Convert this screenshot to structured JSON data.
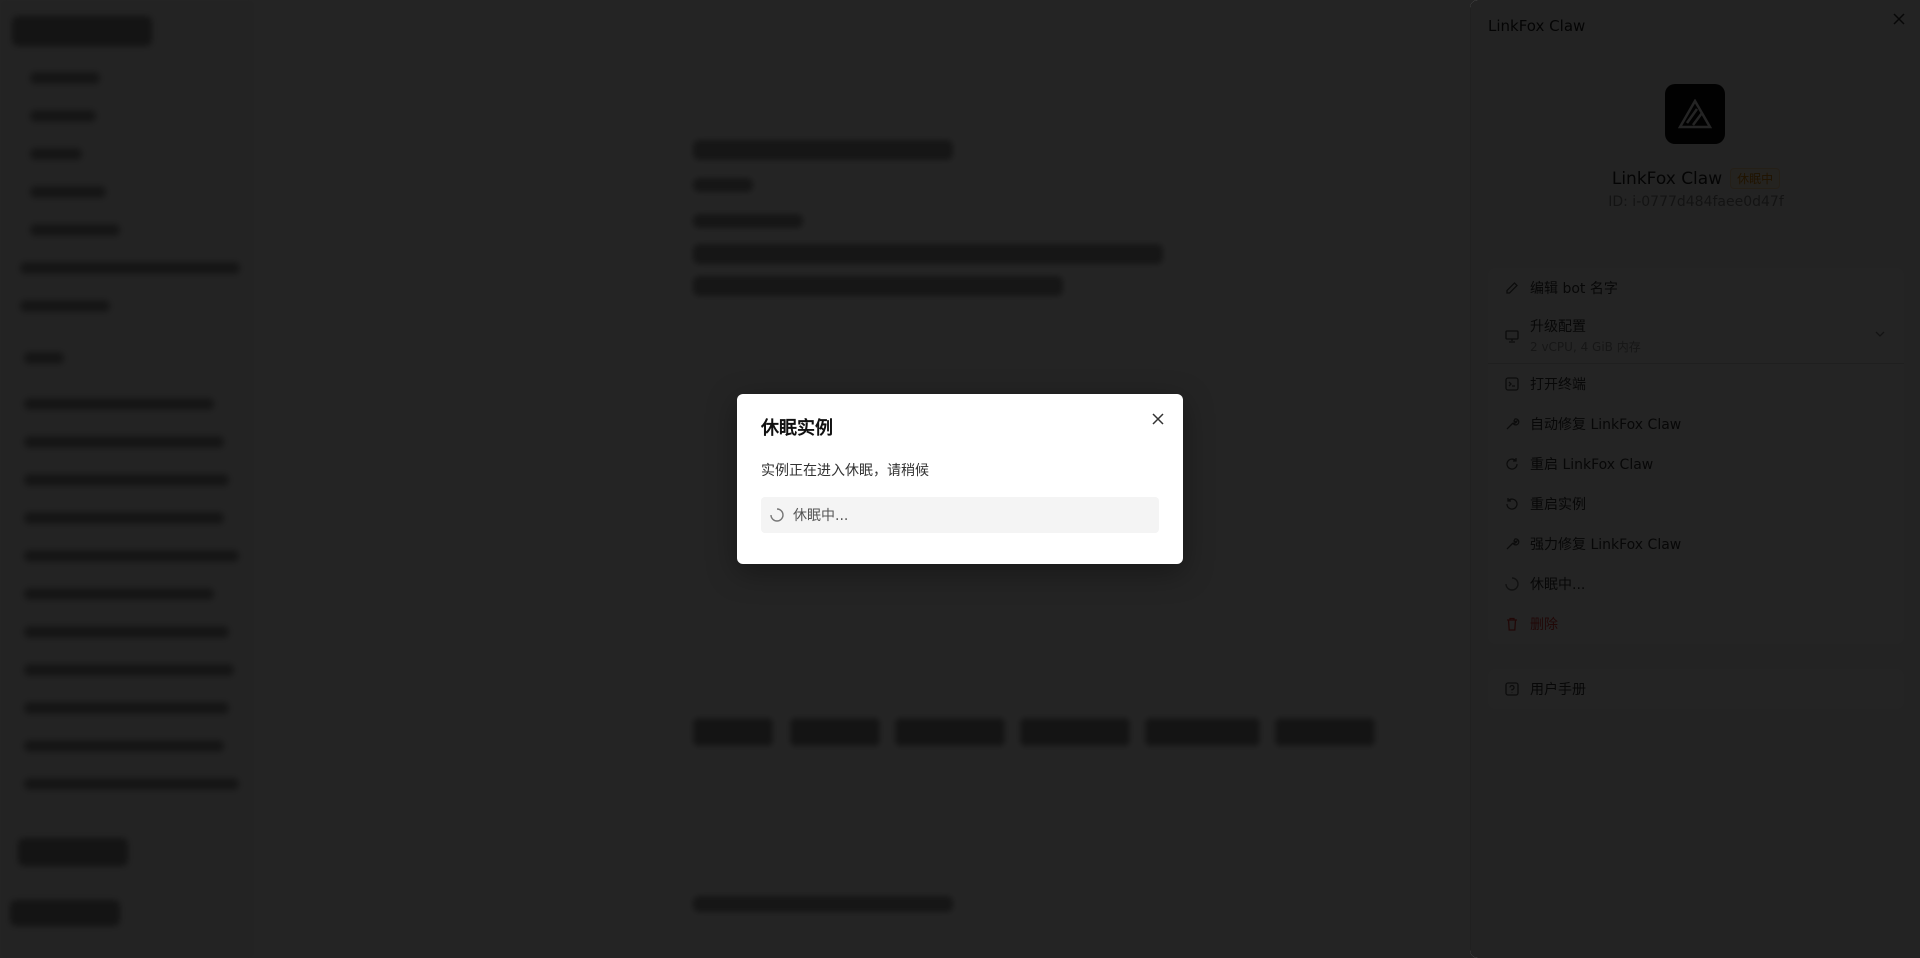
{
  "drawer": {
    "title": "LinkFox Claw",
    "bot_name": "LinkFox Claw",
    "status_badge": "休眠中",
    "bot_id": "ID: i-0777d484faee0d47f",
    "menu": [
      {
        "label": "编辑 bot 名字",
        "icon": "edit-icon"
      },
      {
        "label": "升级配置",
        "sub": "2 vCPU, 4 GiB 内存",
        "icon": "monitor-icon"
      },
      {
        "label": "打开终端",
        "icon": "terminal-icon"
      },
      {
        "label": "自动修复 LinkFox Claw",
        "icon": "wrench-icon"
      },
      {
        "label": "重启 LinkFox Claw",
        "icon": "refresh-icon"
      },
      {
        "label": "重启实例",
        "icon": "rotate-icon"
      },
      {
        "label": "强力修复 LinkFox Claw",
        "icon": "wrench-icon"
      },
      {
        "label": "休眠中...",
        "icon": "spinner-icon"
      },
      {
        "label": "删除",
        "icon": "trash-icon"
      }
    ],
    "manual_label": "用户手册"
  },
  "modal": {
    "title": "休眠实例",
    "description": "实例正在进入休眠，请稍候",
    "status": "休眠中..."
  },
  "colors": {
    "overlay": "#000000",
    "danger": "#e53935",
    "badge_text": "#e08a00"
  }
}
